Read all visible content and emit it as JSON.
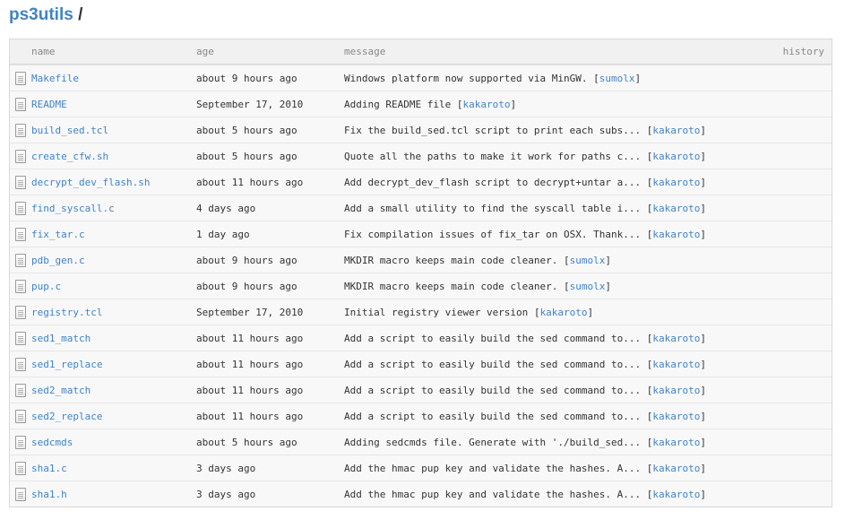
{
  "breadcrumb": {
    "repo": "ps3utils",
    "separator": "/"
  },
  "tree": {
    "headers": {
      "name": "name",
      "age": "age",
      "message": "message",
      "history": "history"
    },
    "rows": [
      {
        "name": "Makefile",
        "age": "about 9 hours ago",
        "message": "Windows platform now supported via MinGW.",
        "author": "sumolx"
      },
      {
        "name": "README",
        "age": "September 17, 2010",
        "message": "Adding README file",
        "author": "kakaroto"
      },
      {
        "name": "build_sed.tcl",
        "age": "about 5 hours ago",
        "message": "Fix the build_sed.tcl script to print each subs...",
        "author": "kakaroto"
      },
      {
        "name": "create_cfw.sh",
        "age": "about 5 hours ago",
        "message": "Quote all the paths to make it work for paths c...",
        "author": "kakaroto"
      },
      {
        "name": "decrypt_dev_flash.sh",
        "age": "about 11 hours ago",
        "message": "Add decrypt_dev_flash script to decrypt+untar a...",
        "author": "kakaroto"
      },
      {
        "name": "find_syscall.c",
        "age": "4 days ago",
        "message": "Add a small utility to find the syscall table i...",
        "author": "kakaroto"
      },
      {
        "name": "fix_tar.c",
        "age": "1 day ago",
        "message": "Fix compilation issues of fix_tar on OSX. Thank...",
        "author": "kakaroto"
      },
      {
        "name": "pdb_gen.c",
        "age": "about 9 hours ago",
        "message": "MKDIR macro keeps main code cleaner.",
        "author": "sumolx"
      },
      {
        "name": "pup.c",
        "age": "about 9 hours ago",
        "message": "MKDIR macro keeps main code cleaner.",
        "author": "sumolx"
      },
      {
        "name": "registry.tcl",
        "age": "September 17, 2010",
        "message": "Initial registry viewer version",
        "author": "kakaroto"
      },
      {
        "name": "sed1_match",
        "age": "about 11 hours ago",
        "message": "Add a script to easily build the sed command to...",
        "author": "kakaroto"
      },
      {
        "name": "sed1_replace",
        "age": "about 11 hours ago",
        "message": "Add a script to easily build the sed command to...",
        "author": "kakaroto"
      },
      {
        "name": "sed2_match",
        "age": "about 11 hours ago",
        "message": "Add a script to easily build the sed command to...",
        "author": "kakaroto"
      },
      {
        "name": "sed2_replace",
        "age": "about 11 hours ago",
        "message": "Add a script to easily build the sed command to...",
        "author": "kakaroto"
      },
      {
        "name": "sedcmds",
        "age": "about 5 hours ago",
        "message": "Adding sedcmds file. Generate with './build_sed...",
        "author": "kakaroto"
      },
      {
        "name": "sha1.c",
        "age": "3 days ago",
        "message": "Add the hmac pup key and validate the hashes. A...",
        "author": "kakaroto"
      },
      {
        "name": "sha1.h",
        "age": "3 days ago",
        "message": "Add the hmac pup key and validate the hashes. A...",
        "author": "kakaroto"
      }
    ]
  },
  "icons": {
    "file": "file-icon"
  },
  "colors": {
    "link": "#4183c4",
    "row_bg": "#f8f8f8",
    "header_bg": "#f1f1f1",
    "border": "#d8d8d8"
  }
}
